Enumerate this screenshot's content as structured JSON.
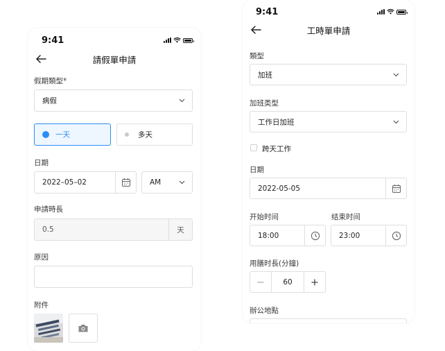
{
  "status_bar": {
    "time": "9:41"
  },
  "leave_form": {
    "title": "請假單申請",
    "leave_type_label": "假期類型*",
    "leave_type_value": "病假",
    "duration_options": [
      "一天",
      "多天"
    ],
    "duration_selected": "一天",
    "date_label": "日期",
    "date_value": "2022–05–02",
    "period_value": "AM",
    "hours_label": "申請時長",
    "hours_value": "0.5",
    "hours_unit": "天",
    "reason_label": "原因",
    "reason_value": "",
    "attachment_label": "附件"
  },
  "timesheet_form": {
    "title": "工時單申請",
    "type_label": "類型",
    "type_value": "加班",
    "ot_type_label": "加班类型",
    "ot_type_value": "工作日加班",
    "cross_day_label": "跨天工作",
    "cross_day_checked": false,
    "date_label": "日期",
    "date_value": "2022-05-05",
    "start_label": "开始时间",
    "start_value": "18:00",
    "end_label": "结束时间",
    "end_value": "23:00",
    "meal_label": "用膳时長(分鐘)",
    "meal_value": "60",
    "office_label": "辦公地點"
  },
  "colors": {
    "accent": "#2b8ef5",
    "border": "#dedede",
    "disabled_bg": "#f6f6f6"
  }
}
